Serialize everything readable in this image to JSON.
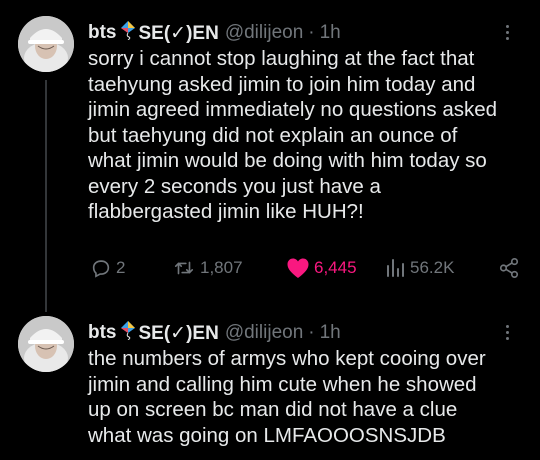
{
  "tweets": [
    {
      "author": {
        "name": "bts",
        "name_suffix": "SE(✓)EN",
        "handle": "@dilijeon",
        "time": "1h"
      },
      "text": "sorry i cannot stop laughing at the fact that\ntaehyung asked jimin to join him today and\njimin agreed immediately no questions asked\nbut taehyung did not explain an ounce of\nwhat jimin would be doing with him today so\nevery 2 seconds you just have a\nflabbergasted jimin like HUH?!",
      "stats": {
        "replies": "2",
        "retweets": "1,807",
        "likes": "6,445",
        "views": "56.2K"
      },
      "liked": true
    },
    {
      "author": {
        "name": "bts",
        "name_suffix": "SE(✓)EN",
        "handle": "@dilijeon",
        "time": "1h"
      },
      "text": "the numbers of armys who kept cooing over\njimin and calling him cute when he showed\nup on screen bc man did not have a clue\nwhat was going on LMFAOOOSNSJDB"
    }
  ],
  "colors": {
    "background": "#000000",
    "text": "#e7e9ea",
    "muted": "#71767b",
    "like": "#f91880"
  },
  "icons": {
    "name_emoji": "kite-icon",
    "reply": "speech-bubble-icon",
    "retweet": "retweet-arrows-icon",
    "like": "heart-icon",
    "views": "bar-chart-icon",
    "share": "share-nodes-icon",
    "more": "more-dots-icon"
  }
}
